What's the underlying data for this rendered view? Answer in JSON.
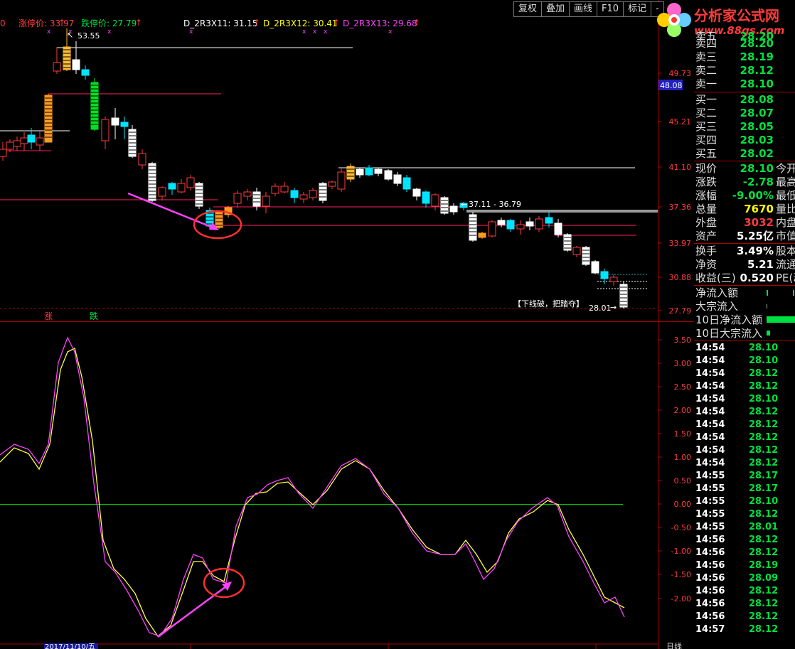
{
  "toolbar": {
    "buttons": [
      "复权",
      "叠加",
      "画线",
      "F10",
      "标记",
      "-"
    ]
  },
  "logo": {
    "title": "分析家公式网",
    "url": "www.88gs.com"
  },
  "header": {
    "left_stub": "0",
    "limit_up_label": "涨停价: 33.97",
    "limit_down_label": "跌停价: 27.79",
    "ind1": "D_2R3X11: 31.15",
    "ind2": "D_2R3X12: 30.41",
    "ind3": "D_2R3X13: 29.68",
    "colors": {
      "up": "#ff3c3c",
      "down": "#00e040",
      "white": "#ffffff",
      "yellow": "#ffff00",
      "magenta": "#ff40ff"
    }
  },
  "price_axis": {
    "ticks": [
      "49.73",
      "45.21",
      "41.10",
      "37.36",
      "33.97",
      "30.88",
      "27.79"
    ],
    "current_tag": "48.08"
  },
  "indicator_axis": {
    "ticks": [
      "3.50",
      "3.00",
      "2.50",
      "2.00",
      "1.50",
      "1.00",
      "0.50",
      "0.00",
      "-0.50",
      "-1.00",
      "-1.50",
      "-2.00"
    ]
  },
  "annotations": {
    "peak": "53.55",
    "range": "37.11 - 36.79",
    "note": "【下线破，把踏夺】",
    "low": "28.01",
    "limit_up_mark": "涨",
    "limit_down_mark": "跌",
    "date": "2017/11/10/五",
    "bottom_right": "日线"
  },
  "quotes": {
    "asks": [
      {
        "label": "卖五",
        "price": "28.20"
      },
      {
        "label": "卖四",
        "price": "28.20"
      },
      {
        "label": "卖三",
        "price": "28.19"
      },
      {
        "label": "卖二",
        "price": "28.12"
      },
      {
        "label": "卖一",
        "price": "28.10"
      }
    ],
    "bids": [
      {
        "label": "买一",
        "price": "28.08"
      },
      {
        "label": "买二",
        "price": "28.07"
      },
      {
        "label": "买三",
        "price": "28.05"
      },
      {
        "label": "买四",
        "price": "28.03"
      },
      {
        "label": "买五",
        "price": "28.02"
      }
    ],
    "stats": [
      {
        "label": "现价",
        "value": "28.10",
        "ext": "今开",
        "color": "#00e040"
      },
      {
        "label": "涨跌",
        "value": "-2.78",
        "ext": "最高",
        "color": "#00e040"
      },
      {
        "label": "涨幅",
        "value": "-9.00%",
        "ext": "最低",
        "color": "#00e040"
      },
      {
        "label": "总量",
        "value": "7670",
        "ext": "量比",
        "color": "#ffff00"
      },
      {
        "label": "外盘",
        "value": "3032",
        "ext": "内盘",
        "color": "#ff3c3c"
      },
      {
        "label": "资产",
        "value": "5.25亿",
        "ext": "市值",
        "color": "#ffffff"
      },
      {
        "label": "换手",
        "value": "3.49%",
        "ext": "股本",
        "color": "#ffffff"
      },
      {
        "label": "净资",
        "value": "5.21",
        "ext": "流通",
        "color": "#ffffff"
      },
      {
        "label": "收益(三)",
        "value": "0.520",
        "ext": "PE(动)",
        "color": "#ffffff"
      }
    ],
    "flows": [
      {
        "label": "净流入额"
      },
      {
        "label": "大宗流入"
      },
      {
        "label": "10日净流入额"
      },
      {
        "label": "10日大宗流入"
      }
    ]
  },
  "ticks": [
    {
      "time": "14:54",
      "price": "28.10"
    },
    {
      "time": "14:54",
      "price": "28.10"
    },
    {
      "time": "14:54",
      "price": "28.12"
    },
    {
      "time": "14:54",
      "price": "28.12"
    },
    {
      "time": "14:54",
      "price": "28.10"
    },
    {
      "time": "14:54",
      "price": "28.12"
    },
    {
      "time": "14:54",
      "price": "28.12"
    },
    {
      "time": "14:54",
      "price": "28.12"
    },
    {
      "time": "14:54",
      "price": "28.12"
    },
    {
      "time": "14:54",
      "price": "28.12"
    },
    {
      "time": "14:55",
      "price": "28.17"
    },
    {
      "time": "14:55",
      "price": "28.17"
    },
    {
      "time": "14:55",
      "price": "28.10"
    },
    {
      "time": "14:55",
      "price": "28.12"
    },
    {
      "time": "14:55",
      "price": "28.01"
    },
    {
      "time": "14:56",
      "price": "28.12"
    },
    {
      "time": "14:56",
      "price": "28.12"
    },
    {
      "time": "14:56",
      "price": "28.19"
    },
    {
      "time": "14:56",
      "price": "28.09"
    },
    {
      "time": "14:56",
      "price": "28.12"
    },
    {
      "time": "14:56",
      "price": "28.12"
    },
    {
      "time": "14:56",
      "price": "28.12"
    },
    {
      "time": "14:57",
      "price": "28.12"
    }
  ]
}
